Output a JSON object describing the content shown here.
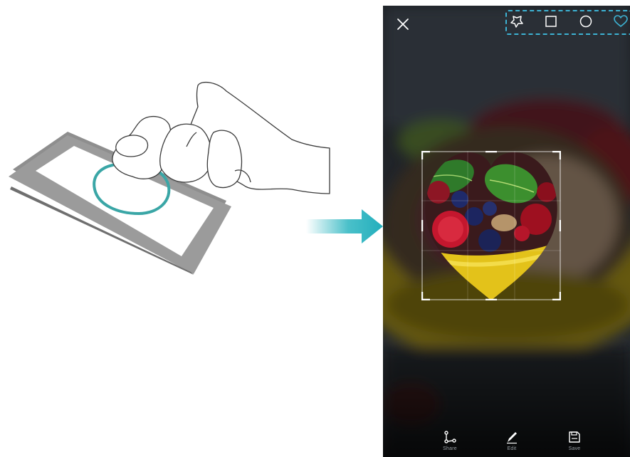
{
  "illustration": {
    "gesture": "knuckle-draw-circle",
    "accent_color": "#3aa6a6"
  },
  "arrow": {
    "color": "#2ab5c0"
  },
  "screen": {
    "toolbar": {
      "close_icon": "close-icon",
      "shapes": [
        {
          "id": "freeform",
          "icon": "freeform-shape-icon"
        },
        {
          "id": "rectangle",
          "icon": "square-icon"
        },
        {
          "id": "circle",
          "icon": "circle-icon"
        },
        {
          "id": "heart",
          "icon": "heart-icon",
          "selected": true
        }
      ],
      "highlight_color": "#3db3d4"
    },
    "crop": {
      "shape": "heart"
    },
    "actions": [
      {
        "id": "share",
        "label": "Share",
        "icon": "share-icon"
      },
      {
        "id": "edit",
        "label": "Edit",
        "icon": "edit-icon"
      },
      {
        "id": "save",
        "label": "Save",
        "icon": "save-icon"
      }
    ]
  }
}
